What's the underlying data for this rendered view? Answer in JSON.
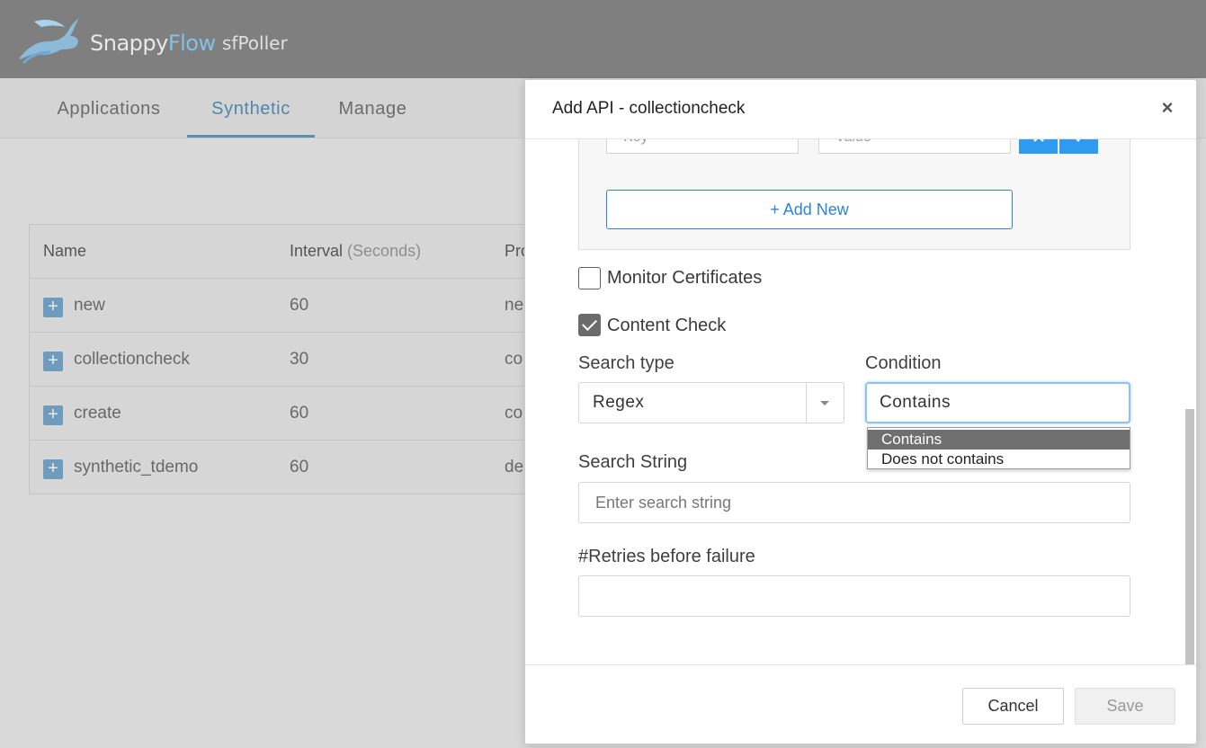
{
  "header": {
    "brand_part1": "Snappy",
    "brand_part2": "Flow",
    "product": "sfPoller",
    "logo_icon": "rabbit-logo-icon"
  },
  "tabs": [
    {
      "label": "Applications",
      "active": false
    },
    {
      "label": "Synthetic",
      "active": true
    },
    {
      "label": "Manage",
      "active": false
    }
  ],
  "table": {
    "columns": {
      "name": "Name",
      "interval": "Interval",
      "interval_unit": "(Seconds)",
      "protocol": "Pro"
    },
    "rows": [
      {
        "name": "new",
        "interval": "60",
        "third": "ne"
      },
      {
        "name": "collectioncheck",
        "interval": "30",
        "third": "co"
      },
      {
        "name": "create",
        "interval": "60",
        "third": "co"
      },
      {
        "name": "synthetic_tdemo",
        "interval": "60",
        "third": "de"
      }
    ],
    "expand_symbol": "+"
  },
  "modal": {
    "title": "Add API - collectioncheck",
    "close_symbol": "×",
    "headers": {
      "key_placeholder": "Key",
      "value_placeholder": "Value",
      "remove_icon": "close-icon",
      "confirm_icon": "check-icon",
      "add_new_label": "+ Add New"
    },
    "monitor_certificates": {
      "label": "Monitor Certificates",
      "checked": false
    },
    "content_check": {
      "label": "Content Check",
      "checked": true
    },
    "search_type": {
      "label": "Search type",
      "value": "Regex"
    },
    "condition": {
      "label": "Condition",
      "value": "Contains",
      "options": [
        "Contains",
        "Does not contains"
      ],
      "selected_index": 0
    },
    "search_string": {
      "label": "Search String",
      "placeholder": "Enter search string",
      "value": ""
    },
    "retries": {
      "label": "#Retries before failure",
      "value": ""
    },
    "footer": {
      "cancel_label": "Cancel",
      "save_label": "Save"
    }
  },
  "colors": {
    "topbar": "#7f7f7f",
    "accent_blue": "#2a85d4",
    "tab_active": "#4f86aa",
    "button_blue": "#2e9bf0"
  }
}
